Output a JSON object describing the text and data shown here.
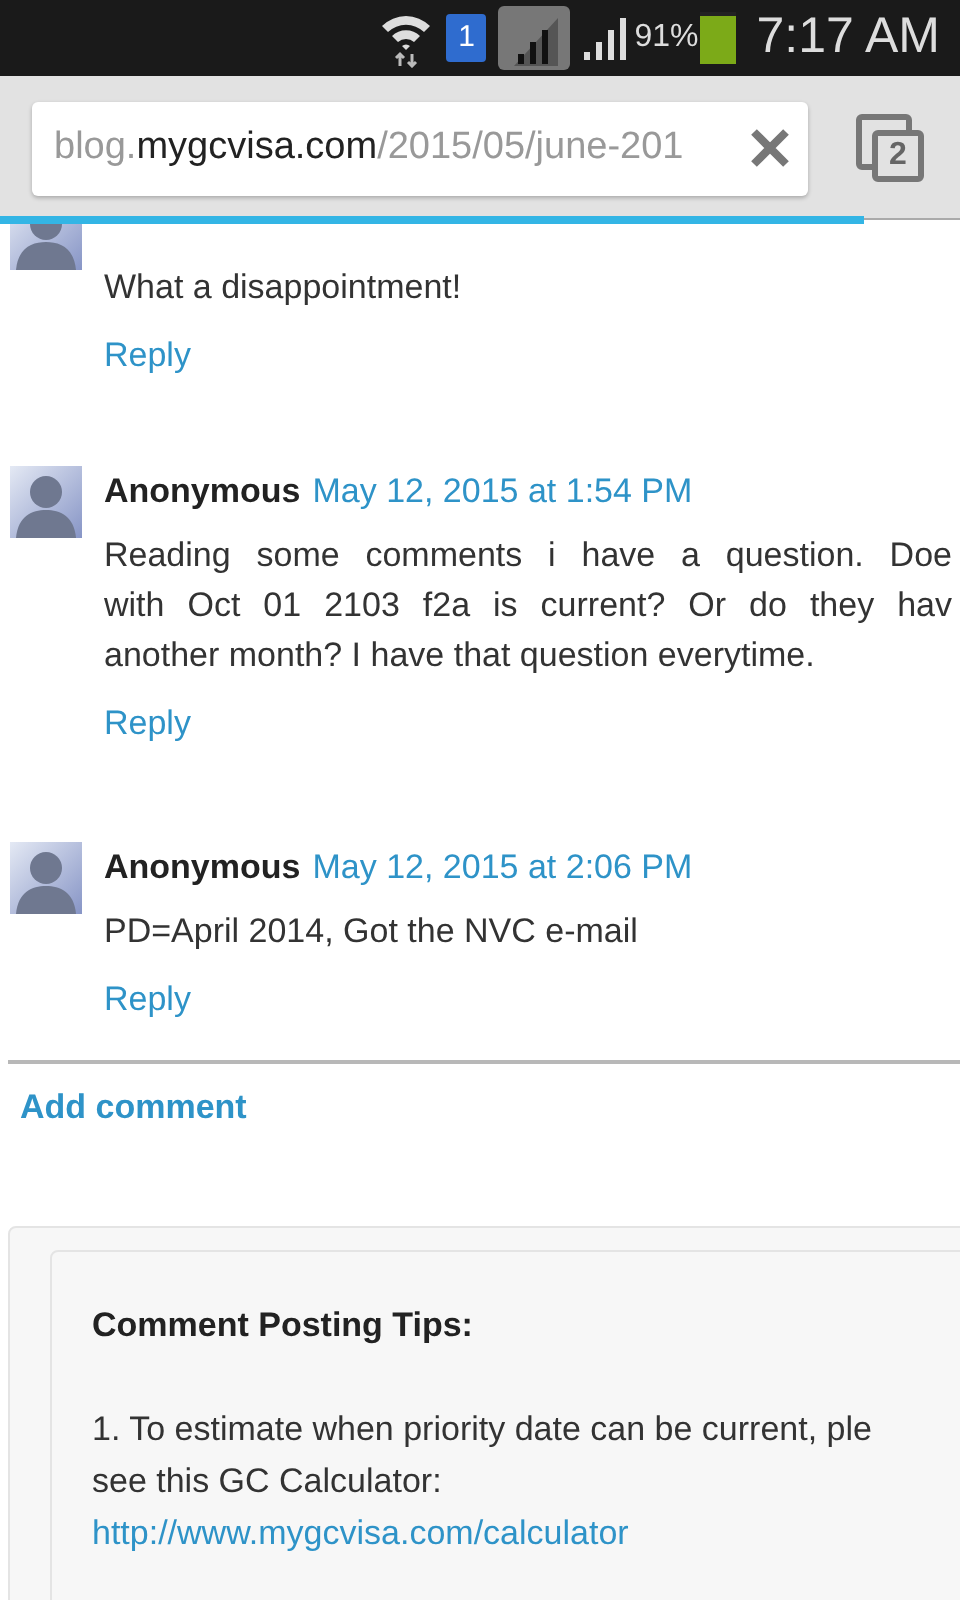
{
  "status_bar": {
    "sim_badge": "1",
    "battery_percent": "91%",
    "time": "7:17 AM"
  },
  "toolbar": {
    "url_prefix": "blog.",
    "url_host": "mygcvisa.com",
    "url_path": "/2015/05/june-201",
    "tab_count": "2"
  },
  "comments": [
    {
      "lines": [
        "What a disappointment!"
      ],
      "reply": "Reply"
    },
    {
      "author": "Anonymous",
      "date": "May 12, 2015 at 1:54 PM",
      "lines": [
        "Reading some comments i have a question. Doe",
        "with Oct 01 2103 f2a is current? Or do they hav",
        "another month? I have that question everytime."
      ],
      "reply": "Reply"
    },
    {
      "author": "Anonymous",
      "date": "May 12, 2015 at 2:06 PM",
      "lines": [
        "PD=April 2014, Got the NVC e-mail"
      ],
      "reply": "Reply"
    }
  ],
  "add_comment": "Add comment",
  "tips": {
    "title": "Comment Posting Tips:",
    "lines": [
      "1. To estimate when priority date can be current, ple",
      "see this GC Calculator:"
    ],
    "link": "http://www.mygcvisa.com/calculator"
  }
}
